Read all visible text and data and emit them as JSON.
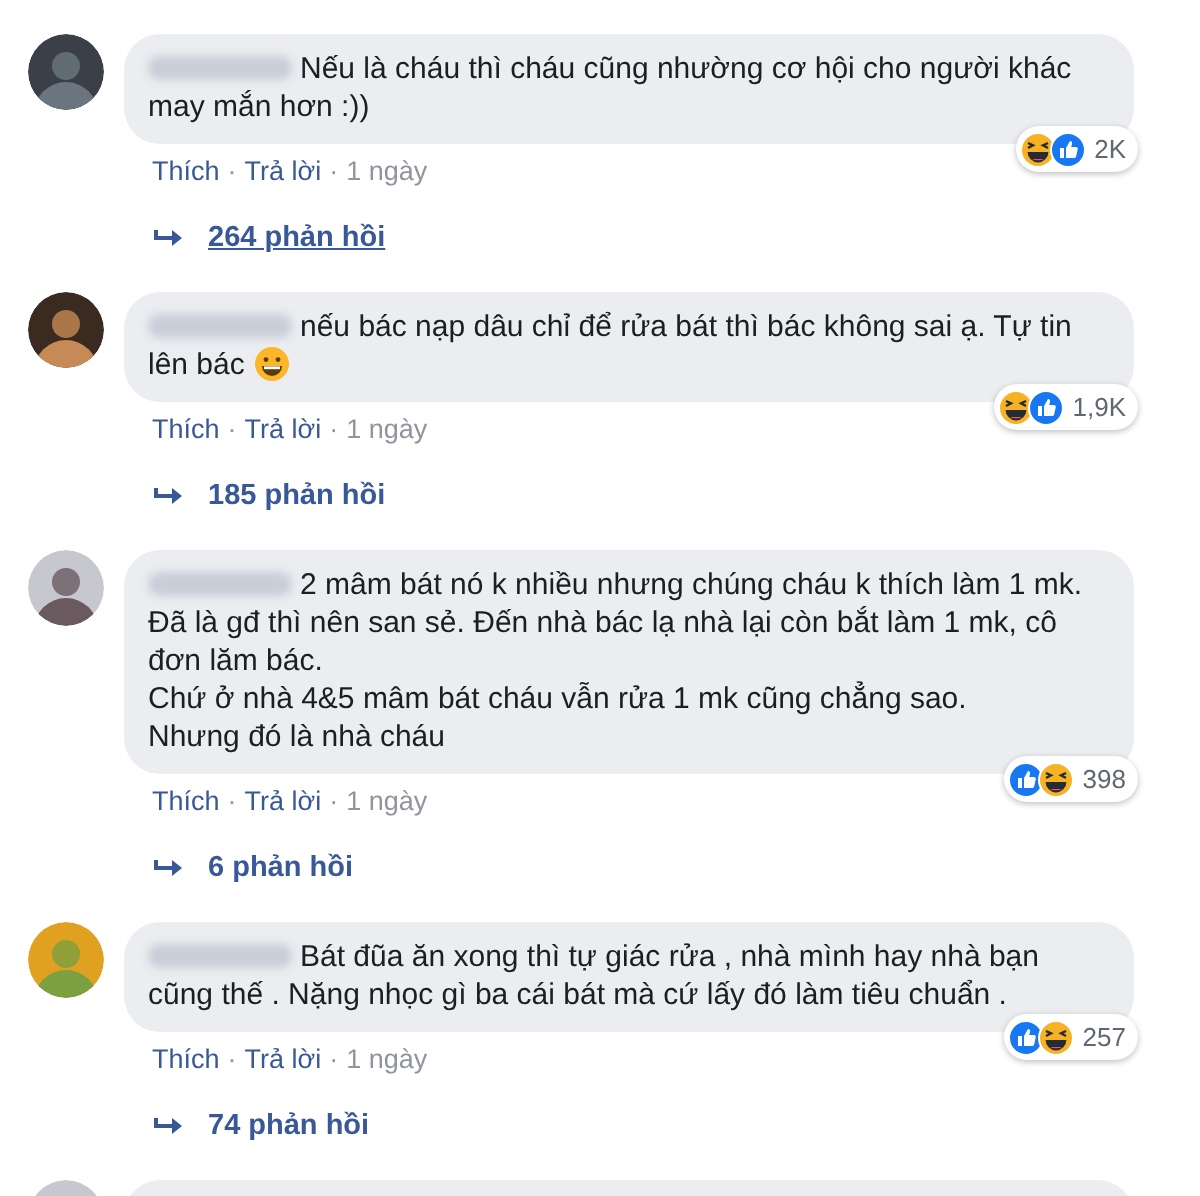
{
  "comments": [
    {
      "body": [
        {
          "kind": "text",
          "text": "Nếu là cháu thì cháu cũng nhường cơ hội cho người khác may mắn hơn :))"
        }
      ],
      "reactions": [
        {
          "kind": "haha"
        },
        {
          "kind": "like"
        }
      ],
      "reaction_count": "2K",
      "actions": [
        {
          "kind": "link",
          "text": "Thích"
        },
        {
          "kind": "dot",
          "text": "·"
        },
        {
          "kind": "link",
          "text": "Trả lời"
        },
        {
          "kind": "dot",
          "text": "·"
        },
        {
          "kind": "time",
          "text": "1 ngày"
        }
      ],
      "replies": {
        "label": "264 phản hồi",
        "hovered": true
      }
    },
    {
      "body": [
        {
          "kind": "text",
          "text": "nếu bác nạp dâu chỉ để rửa bát thì bác không sai ạ. Tự tin lên bác "
        },
        {
          "kind": "emoji"
        }
      ],
      "reactions": [
        {
          "kind": "haha"
        },
        {
          "kind": "like"
        }
      ],
      "reaction_count": "1,9K",
      "actions": [
        {
          "kind": "link",
          "text": "Thích"
        },
        {
          "kind": "dot",
          "text": "·"
        },
        {
          "kind": "link",
          "text": "Trả lời"
        },
        {
          "kind": "dot",
          "text": "·"
        },
        {
          "kind": "time",
          "text": "1 ngày"
        }
      ],
      "replies": {
        "label": "185 phản hồi",
        "hovered": false
      }
    },
    {
      "body": [
        {
          "kind": "text",
          "text": "2 mâm bát nó k nhiều nhưng chúng cháu k thích làm 1 mk.\nĐã là gđ thì nên san sẻ. Đến nhà bác lạ nhà lại còn bắt làm 1 mk, cô đơn lăm bác.\nChứ ở nhà 4&5 mâm bát cháu vẫn rửa 1 mk cũng chẳng sao.\nNhưng đó là nhà cháu"
        }
      ],
      "reactions": [
        {
          "kind": "like"
        },
        {
          "kind": "haha"
        }
      ],
      "reaction_count": "398",
      "actions": [
        {
          "kind": "link",
          "text": "Thích"
        },
        {
          "kind": "dot",
          "text": "·"
        },
        {
          "kind": "link",
          "text": "Trả lời"
        },
        {
          "kind": "dot",
          "text": "·"
        },
        {
          "kind": "time",
          "text": "1 ngày"
        }
      ],
      "replies": {
        "label": "6 phản hồi",
        "hovered": false
      }
    },
    {
      "body": [
        {
          "kind": "text",
          "text": "Bát đũa ăn xong thì tự giác rửa , nhà mình hay nhà bạn cũng thế . Nặng nhọc gì ba cái bát mà cứ lấy đó làm tiêu chuẩn ."
        }
      ],
      "reactions": [
        {
          "kind": "like"
        },
        {
          "kind": "haha"
        }
      ],
      "reaction_count": "257",
      "actions": [
        {
          "kind": "link",
          "text": "Thích"
        },
        {
          "kind": "dot",
          "text": "·"
        },
        {
          "kind": "link",
          "text": "Trả lời"
        },
        {
          "kind": "dot",
          "text": "·"
        },
        {
          "kind": "time",
          "text": "1 ngày"
        }
      ],
      "replies": {
        "label": "74 phản hồi",
        "hovered": false
      }
    }
  ]
}
